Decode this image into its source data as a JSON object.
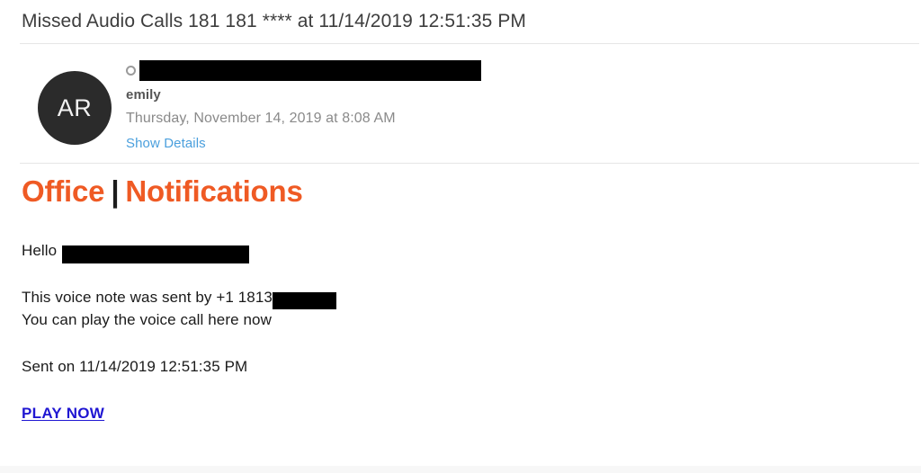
{
  "window": {
    "subject": "Missed Audio Calls 181 181 **** at 11/14/2019 12:51:35 PM"
  },
  "sender": {
    "avatar_initials": "AR",
    "status_icon": "contact-circle-icon",
    "email_redacted": true,
    "display_name": "emily",
    "date": "Thursday, November 14, 2019 at 8:08 AM",
    "show_details_label": "Show Details"
  },
  "message": {
    "brand": {
      "first_word": "Office",
      "separator": "|",
      "second_word": "Notifications",
      "color": "#ef5a24"
    },
    "greeting": "Hello",
    "greeting_name_redacted": true,
    "line_voice_note": "This voice note was sent by +1 1813",
    "phone_redacted": true,
    "line_play_hint": "You can play the voice call here now",
    "line_sent_on": "Sent on 11/14/2019 12:51:35 PM",
    "play_link_label": "PLAY NOW",
    "play_link_color": "#1f16d2"
  }
}
